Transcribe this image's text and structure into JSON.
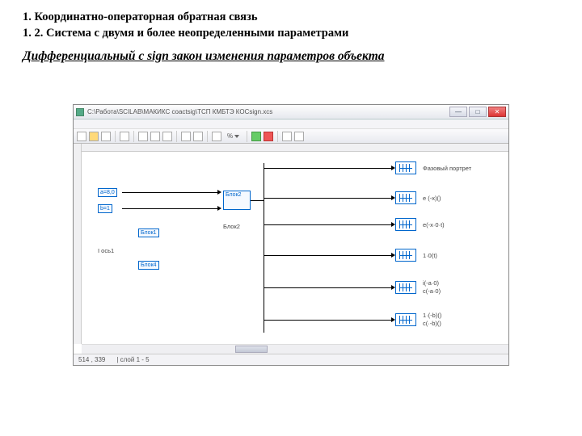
{
  "slide": {
    "line1": "1. Координатно-операторная обратная связь",
    "line2": "1. 2. Система с двумя и более неопределенными параметрами",
    "subtitle": "Дифференциальный с sign закон изменения параметров объекта"
  },
  "window": {
    "title_path": "C:\\Работа\\SCILAB\\МАКИКС coactsig\\ТСП КМБТЭ КОСsign.xcs",
    "buttons": {
      "min": "—",
      "max": "□",
      "close": "✕"
    },
    "toolbar": {
      "percent": "%"
    },
    "statusbar": {
      "left": "514 , 339",
      "layer": "| слой 1 - 5"
    }
  },
  "canvas": {
    "const_a": "a=8,0",
    "const_b": "b=1",
    "blk1": "Блок1",
    "clock": "I ось1",
    "clock_blk": "Блок4",
    "mux1": "Блок2",
    "mux2": "Блок2",
    "scope1": "Scope",
    "scope1_cap": "Фазовый портрет",
    "scope2": "Scope",
    "scope2_cap": "e (-x)()",
    "scope3": "Scope",
    "scope3_cap": "e(-x·0·t)",
    "scope4": "Scope",
    "scope4_cap": "1·0(t)",
    "scope5": "Scope",
    "scope5_caps": {
      "a": "i(-a·0)",
      "b": "c(-a·0)"
    },
    "scope6": "Scope",
    "scope6_caps": {
      "a": "1·(-b)()",
      "b": "c(·-b)()"
    }
  }
}
